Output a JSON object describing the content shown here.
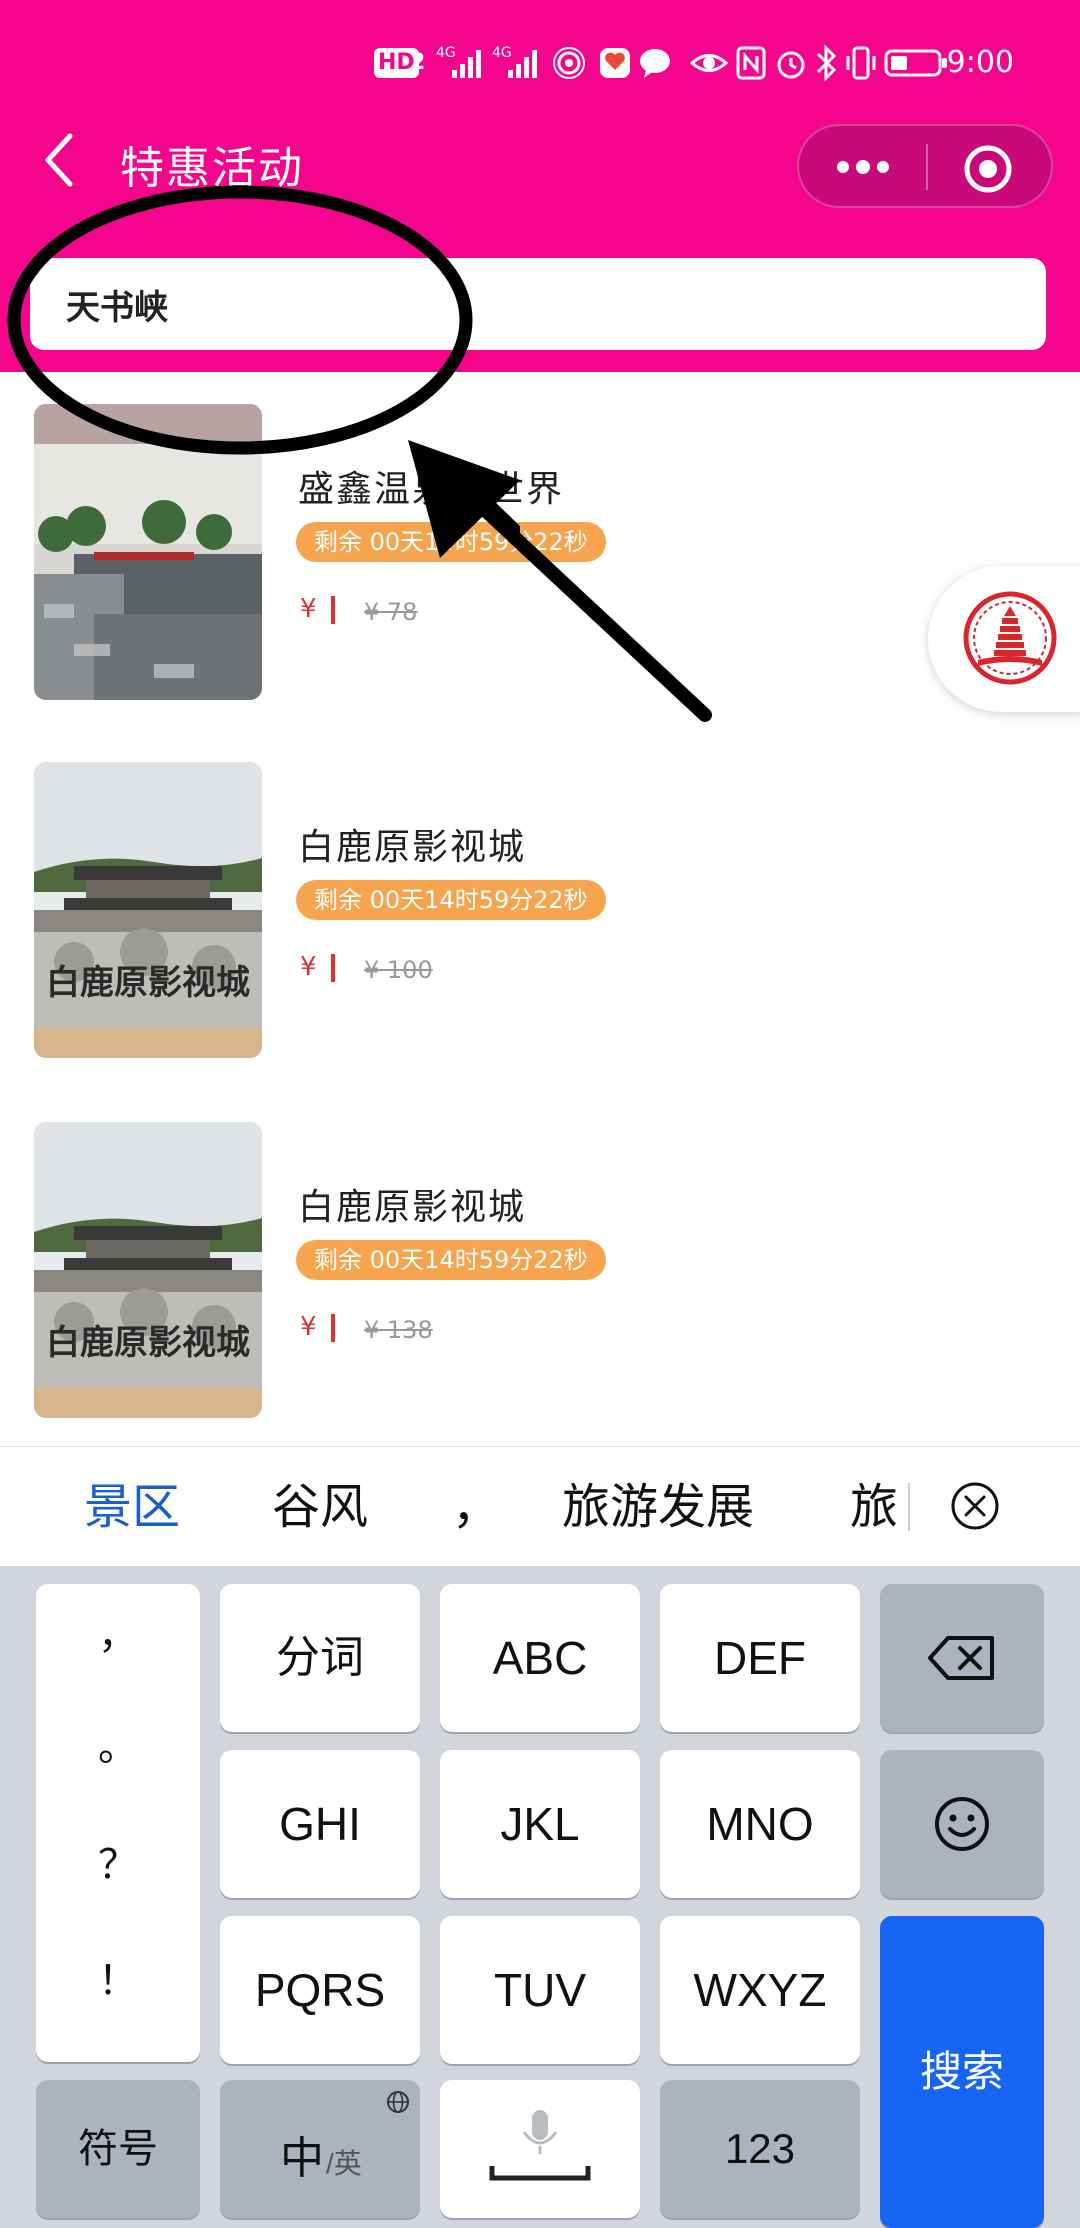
{
  "status_bar": {
    "hd": "HD",
    "sim": "2",
    "net1": "4G",
    "net2": "4G",
    "time": "9:00"
  },
  "header": {
    "back_icon": "chevron-left-icon",
    "title": "特惠活动",
    "more_icon": "more-dots-icon",
    "close_icon": "target-circle-icon",
    "accent_color": "#f5058d"
  },
  "search": {
    "value": "天书峡"
  },
  "items": [
    {
      "name": "盛鑫温泉大世界",
      "timer": "剩余 00天14时59分22秒",
      "currency": "¥",
      "original_price": "¥ 78"
    },
    {
      "name": "白鹿原影视城",
      "timer": "剩余 00天14时59分22秒",
      "currency": "¥",
      "original_price": "¥ 100"
    },
    {
      "name": "白鹿原影视城",
      "timer": "剩余 00天14时59分22秒",
      "currency": "¥",
      "original_price": "¥ 138"
    }
  ],
  "floating_button_icon": "pagoda-logo-icon",
  "candidates": {
    "items": [
      "景区",
      "谷风",
      "，",
      "旅游发展",
      "旅"
    ],
    "close_icon": "close-circle-icon"
  },
  "keyboard": {
    "punct": [
      "，",
      "。",
      "？",
      "！"
    ],
    "row1": [
      "分词",
      "ABC",
      "DEF"
    ],
    "row2": [
      "GHI",
      "JKL",
      "MNO"
    ],
    "row3": [
      "PQRS",
      "TUV",
      "WXYZ"
    ],
    "symbols": "符号",
    "lang_main": "中",
    "lang_sub": "/英",
    "num": "123",
    "search": "搜索",
    "delete_icon": "backspace-icon",
    "emoji_icon": "smiley-icon",
    "mic_icon": "microphone-icon",
    "globe_icon": "globe-icon",
    "search_color": "#1765f5"
  }
}
